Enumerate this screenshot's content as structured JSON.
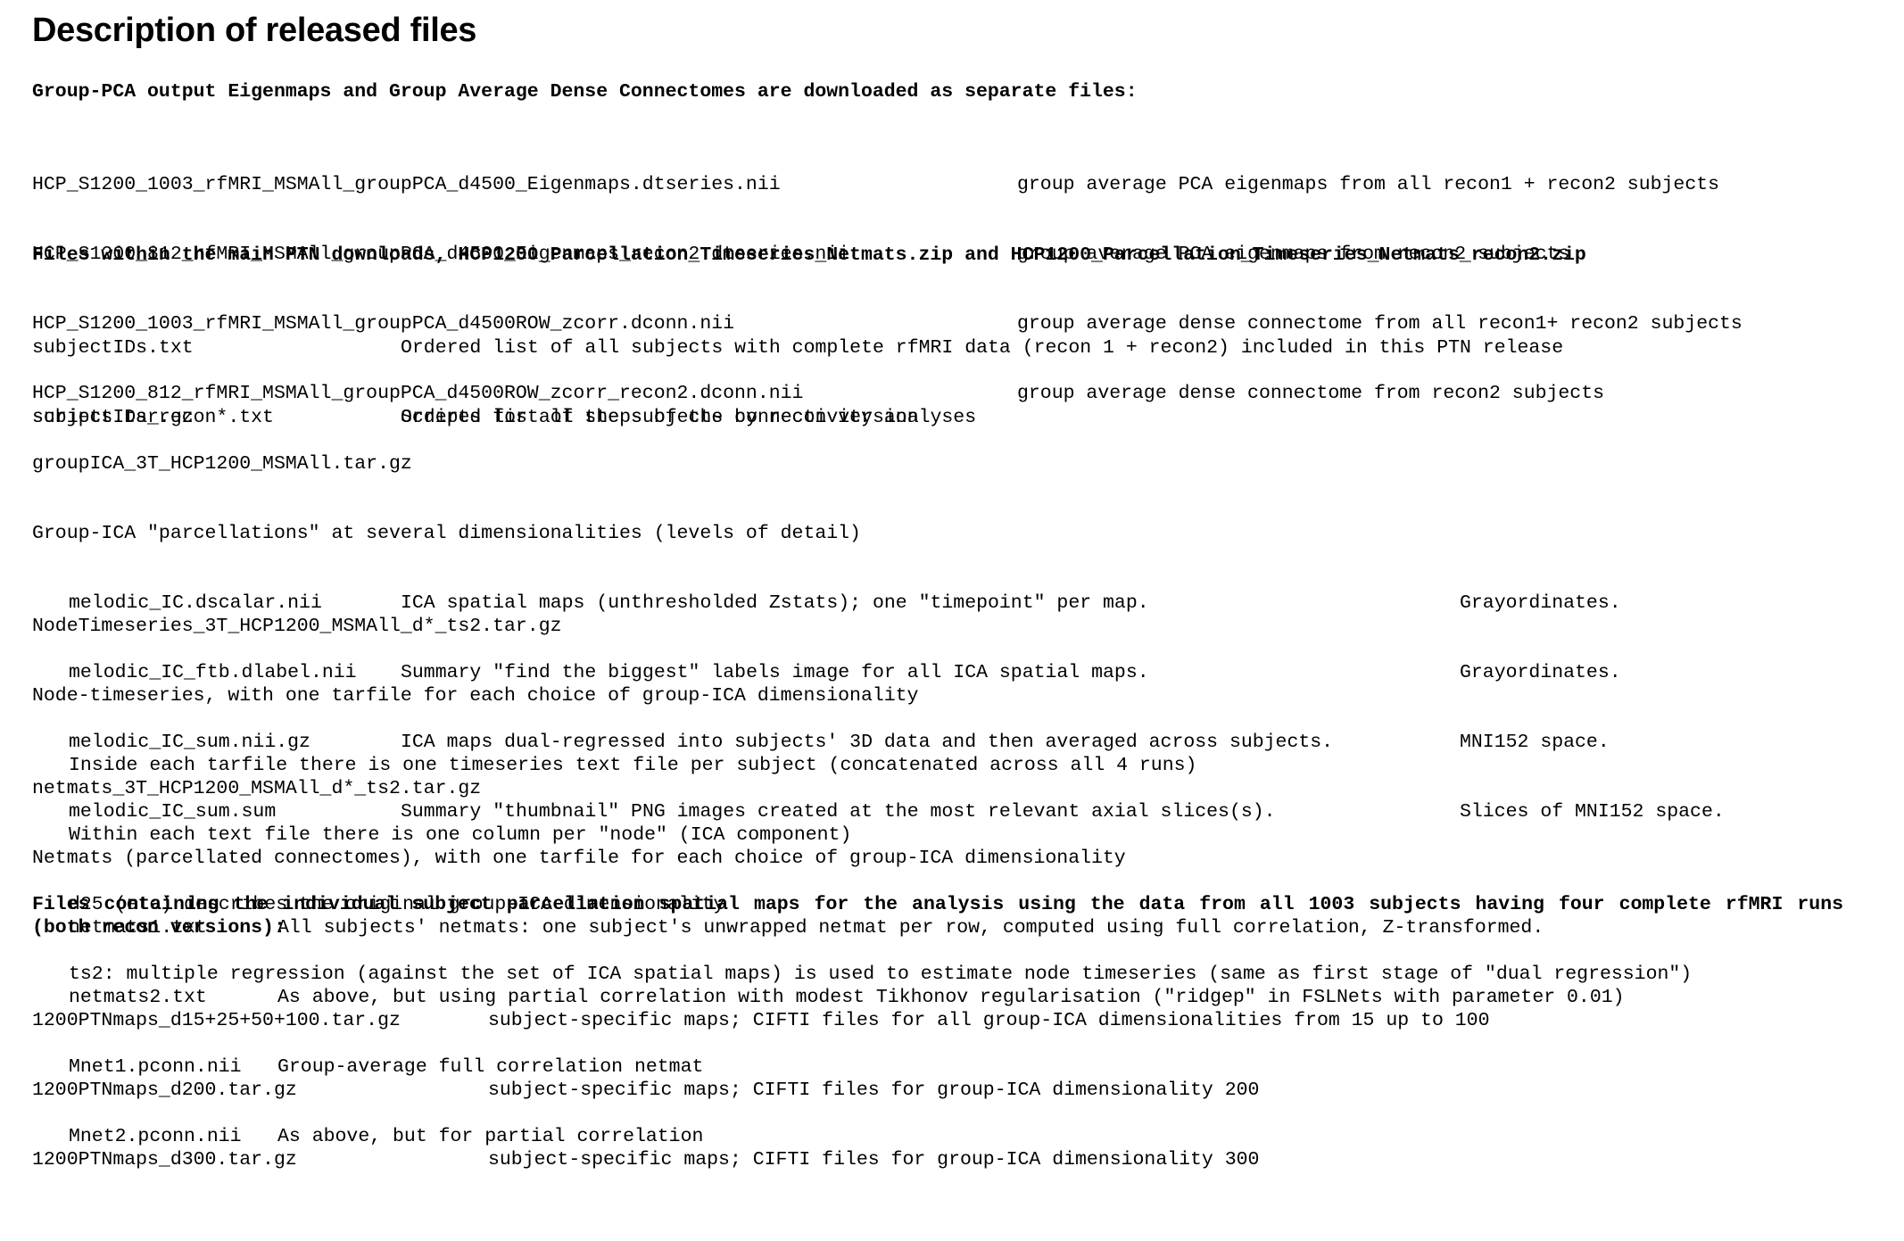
{
  "title": "Description of released files",
  "sections": {
    "eigen": {
      "heading": "Group-PCA output Eigenmaps and Group Average Dense Connectomes are downloaded as separate files:",
      "rows": [
        {
          "file": "HCP_S1200_1003_rfMRI_MSMAll_groupPCA_d4500_Eigenmaps.dtseries.nii",
          "desc": "group average PCA eigenmaps from all recon1 + recon2 subjects"
        },
        {
          "file": "HCP_S1200_812_rfMRI_MSMAll_groupPCA_d4500_Eigenmaps_recon2.dtseries.nii",
          "desc": "group average PCA eigenmaps from recon2 subjects"
        },
        {
          "file": "HCP_S1200_1003_rfMRI_MSMAll_groupPCA_d4500ROW_zcorr.dconn.nii",
          "desc": "group average dense connectome from all recon1+ recon2 subjects"
        },
        {
          "file": "HCP_S1200_812_rfMRI_MSMAll_groupPCA_d4500ROW_zcorr_recon2.dconn.nii",
          "desc": "group average dense connectome from recon2 subjects"
        }
      ]
    },
    "ptn": {
      "heading": "Files within the main PTN downloads, HCP1200_Parcellation_Timeseries_Netmats.zip and HCP1200_Parcellation_Timeseries_Netmats_recon2.zip",
      "rows": [
        {
          "file": "subjectIDs.txt",
          "desc": "Ordered list of all subjects with complete rfMRI data (recon 1 + recon2) included in this PTN release"
        },
        {
          "file": "subjectIDs_recon*.txt",
          "desc": "Ordered list of the subjects by recon version"
        }
      ],
      "scripts": {
        "file": "scripts.tar.gz",
        "desc": "Scripts for all steps of the connectivity analyses"
      }
    },
    "groupica": {
      "file": "groupICA_3T_HCP1200_MSMAll.tar.gz",
      "intro": "Group-ICA \"parcellations\" at several dimensionalities (levels of detail)",
      "rows": [
        {
          "file": "melodic_IC.dscalar.nii",
          "desc": "ICA spatial maps (unthresholded Zstats); one \"timepoint\" per map.",
          "space": "Grayordinates."
        },
        {
          "file": "melodic_IC_ftb.dlabel.nii",
          "desc": "Summary \"find the biggest\" labels image for all ICA spatial maps.",
          "space": "Grayordinates."
        },
        {
          "file": "melodic_IC_sum.nii.gz",
          "desc": "ICA maps dual-regressed into subjects' 3D data and then averaged across subjects.",
          "space": "MNI152 space."
        },
        {
          "file": "melodic_IC_sum.sum",
          "desc": "Summary \"thumbnail\" PNG images created at the most relevant axial slices(s).",
          "space": "Slices of MNI152 space."
        }
      ]
    },
    "nodets": {
      "file": "NodeTimeseries_3T_HCP1200_MSMAll_d*_ts2.tar.gz",
      "intro": "Node-timeseries, with one tarfile for each choice of group-ICA dimensionality",
      "lines": [
        "Inside each tarfile there is one timeseries text file per subject (concatenated across all 4 runs)",
        "Within each text file there is one column per \"node\" (ICA component)",
        "d25 (etc) describes the original group-ICA dimensionality",
        "ts2: multiple regression (against the set of ICA spatial maps) is used to estimate node timeseries (same as first stage of \"dual regression\")"
      ]
    },
    "netmats": {
      "file": "netmats_3T_HCP1200_MSMAll_d*_ts2.tar.gz",
      "intro": "Netmats (parcellated connectomes), with one tarfile for each choice of group-ICA dimensionality",
      "rows": [
        {
          "file": "netmats1.txt",
          "desc": "All subjects' netmats: one subject's unwrapped netmat per row, computed using full correlation, Z-transformed."
        },
        {
          "file": "netmats2.txt",
          "desc": "As above, but using partial correlation with modest Tikhonov regularisation (\"ridgep\" in FSLNets with parameter 0.01)"
        },
        {
          "file": "Mnet1.pconn.nii",
          "desc": "Group-average full correlation netmat"
        },
        {
          "file": "Mnet2.pconn.nii",
          "desc": "As above, but for partial correlation"
        }
      ]
    },
    "maps": {
      "heading": "Files containing the individual subject parcellation spatial maps for the analysis using the data from all 1003 subjects having four complete rfMRI runs (both recon versions):",
      "rows": [
        {
          "file": "1200PTNmaps_d15+25+50+100.tar.gz",
          "desc": "subject-specific maps; CIFTI files for all group-ICA dimensionalities from 15 up to 100"
        },
        {
          "file": "1200PTNmaps_d200.tar.gz",
          "desc": "subject-specific maps; CIFTI files for group-ICA dimensionality 200"
        },
        {
          "file": "1200PTNmaps_d300.tar.gz",
          "desc": "subject-specific maps; CIFTI files for group-ICA dimensionality 300"
        }
      ]
    }
  }
}
